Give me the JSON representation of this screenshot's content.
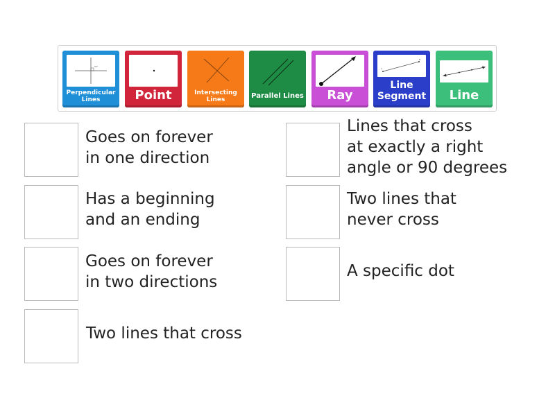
{
  "tiles": [
    {
      "label": "Perpendicular Lines",
      "color": "#1f8fd8",
      "icon": "perpendicular-lines-icon"
    },
    {
      "label": "Point",
      "color": "#d0253b",
      "icon": "point-icon"
    },
    {
      "label": "Intersecting Lines",
      "color": "#f77a18",
      "icon": "intersecting-lines-icon"
    },
    {
      "label": "Parallel Lines",
      "color": "#1e8c45",
      "icon": "parallel-lines-icon"
    },
    {
      "label": "Ray",
      "color": "#c94fd6",
      "icon": "ray-icon"
    },
    {
      "label": "Line Segment",
      "color": "#2b3ec9",
      "icon": "line-segment-icon"
    },
    {
      "label": "Line",
      "color": "#3cbf7a",
      "icon": "line-icon"
    }
  ],
  "definitions": [
    {
      "text": "Goes on forever\nin one direction"
    },
    {
      "text": "Lines that cross\nat exactly a right\nangle or 90 degrees"
    },
    {
      "text": "Has a beginning\nand an ending"
    },
    {
      "text": "Two lines that\nnever cross"
    },
    {
      "text": "Goes on forever\nin two directions"
    },
    {
      "text": "A specific dot"
    },
    {
      "text": "Two lines that cross"
    }
  ]
}
